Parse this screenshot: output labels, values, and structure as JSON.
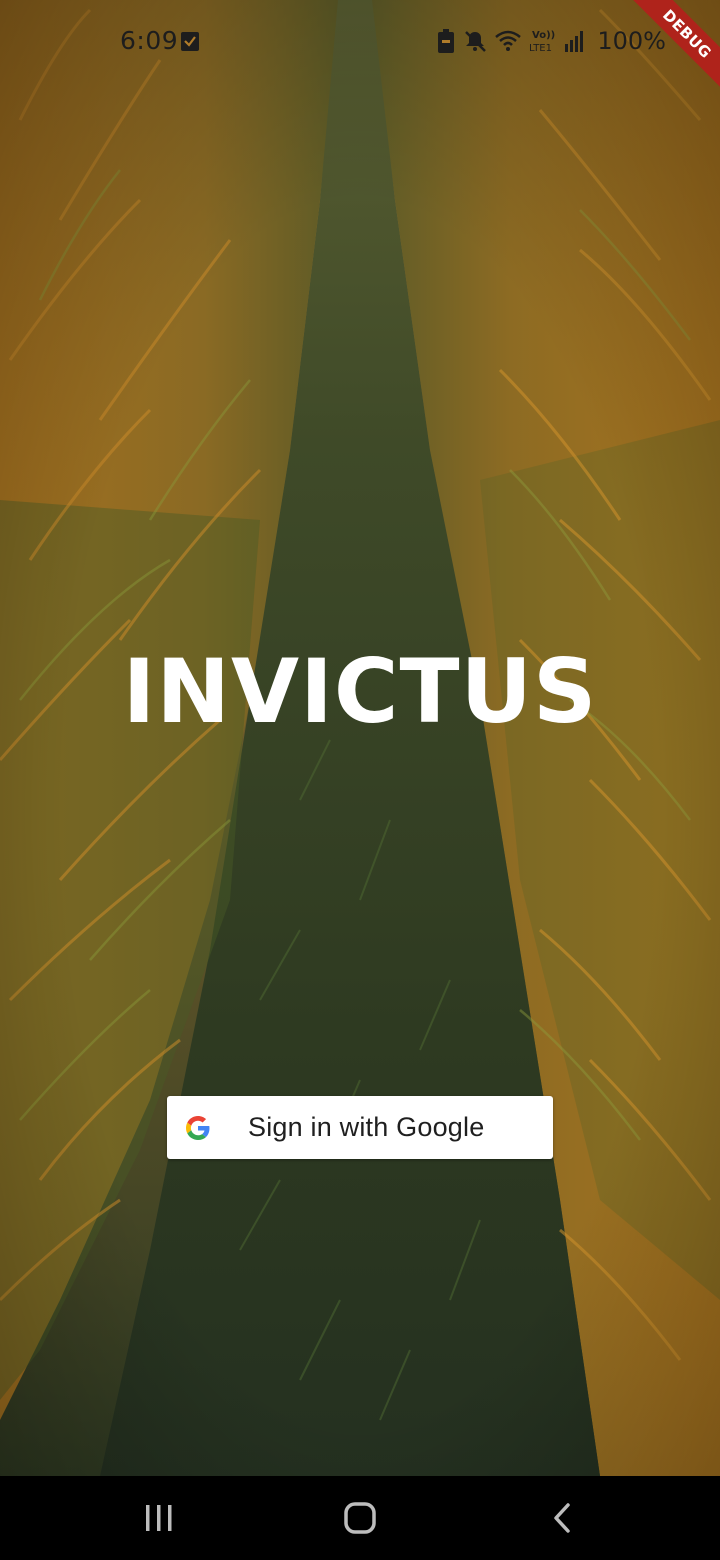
{
  "status_bar": {
    "time": "6:09",
    "battery": "100%",
    "icons": [
      "checklist-icon",
      "battery-saver-icon",
      "mute-icon",
      "wifi-icon",
      "volte-icon",
      "signal-icon"
    ],
    "network_label_top": "Vo))",
    "network_label_bottom": "LTE1"
  },
  "debug_banner": {
    "label": "DEBUG",
    "color": "#b71c1c"
  },
  "app": {
    "title": "INVICTUS"
  },
  "sign_in": {
    "label": "Sign in with Google",
    "icon": "google-g-icon"
  },
  "nav_bar": {
    "buttons": [
      "recent-apps-icon",
      "home-icon",
      "back-icon"
    ]
  },
  "colors": {
    "text_white": "#ffffff",
    "button_bg": "#ffffff",
    "button_text": "#1f1f1f",
    "google_blue": "#4285F4",
    "google_red": "#EA4335",
    "google_yellow": "#FBBC05",
    "google_green": "#34A853"
  }
}
